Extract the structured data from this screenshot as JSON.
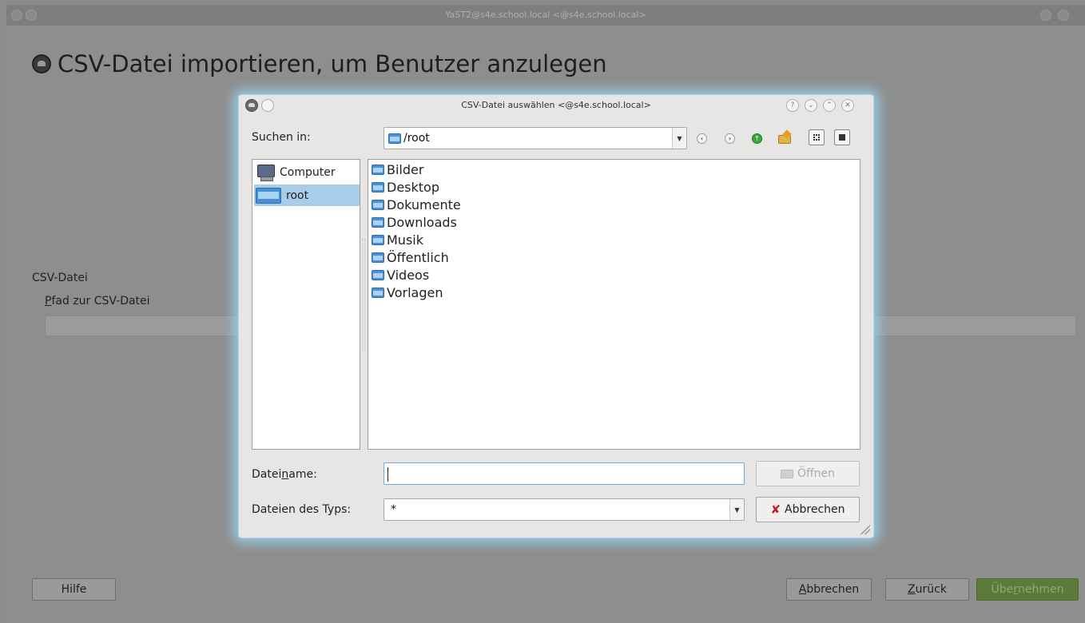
{
  "main_window": {
    "title": "YaST2@s4e.school.local <@s4e.school.local>",
    "page_title": "CSV-Datei importieren, um Benutzer anzulegen",
    "csv_group_label": "CSV-Datei",
    "csv_path_label_first": "P",
    "csv_path_label_rest": "fad zur CSV-Datei",
    "csv_path_value": "",
    "buttons": {
      "help": "Hilfe",
      "cancel_first": "A",
      "cancel_rest": "bbrechen",
      "back_first": "Z",
      "back_rest": "urück",
      "accept_a": "Übe",
      "accept_u": "r",
      "accept_b": "nehmen"
    }
  },
  "dialog": {
    "title": "CSV-Datei auswählen <@s4e.school.local>",
    "window_buttons": [
      "?",
      "⌄",
      "⌃",
      "✕"
    ],
    "look_in_label": "Suchen in:",
    "look_in_value": "/root",
    "places": [
      {
        "label": "Computer",
        "selected": false
      },
      {
        "label": "root",
        "selected": true
      }
    ],
    "files": [
      "Bilder",
      "Desktop",
      "Dokumente",
      "Downloads",
      "Musik",
      "Öffentlich",
      "Videos",
      "Vorlagen"
    ],
    "filename_label_a": "Datei",
    "filename_label_u": "n",
    "filename_label_b": "ame:",
    "filename_value": "",
    "filetype_label": "Dateien des Typs:",
    "filetype_value": "*",
    "open_button": "Öffnen",
    "cancel_button": "Abbrechen"
  },
  "colors": {
    "selection": "#a8cde9",
    "folder": "#4a8fd6",
    "dialog_glow": "#96d2f0",
    "accept_button": "#5d7a3d"
  }
}
